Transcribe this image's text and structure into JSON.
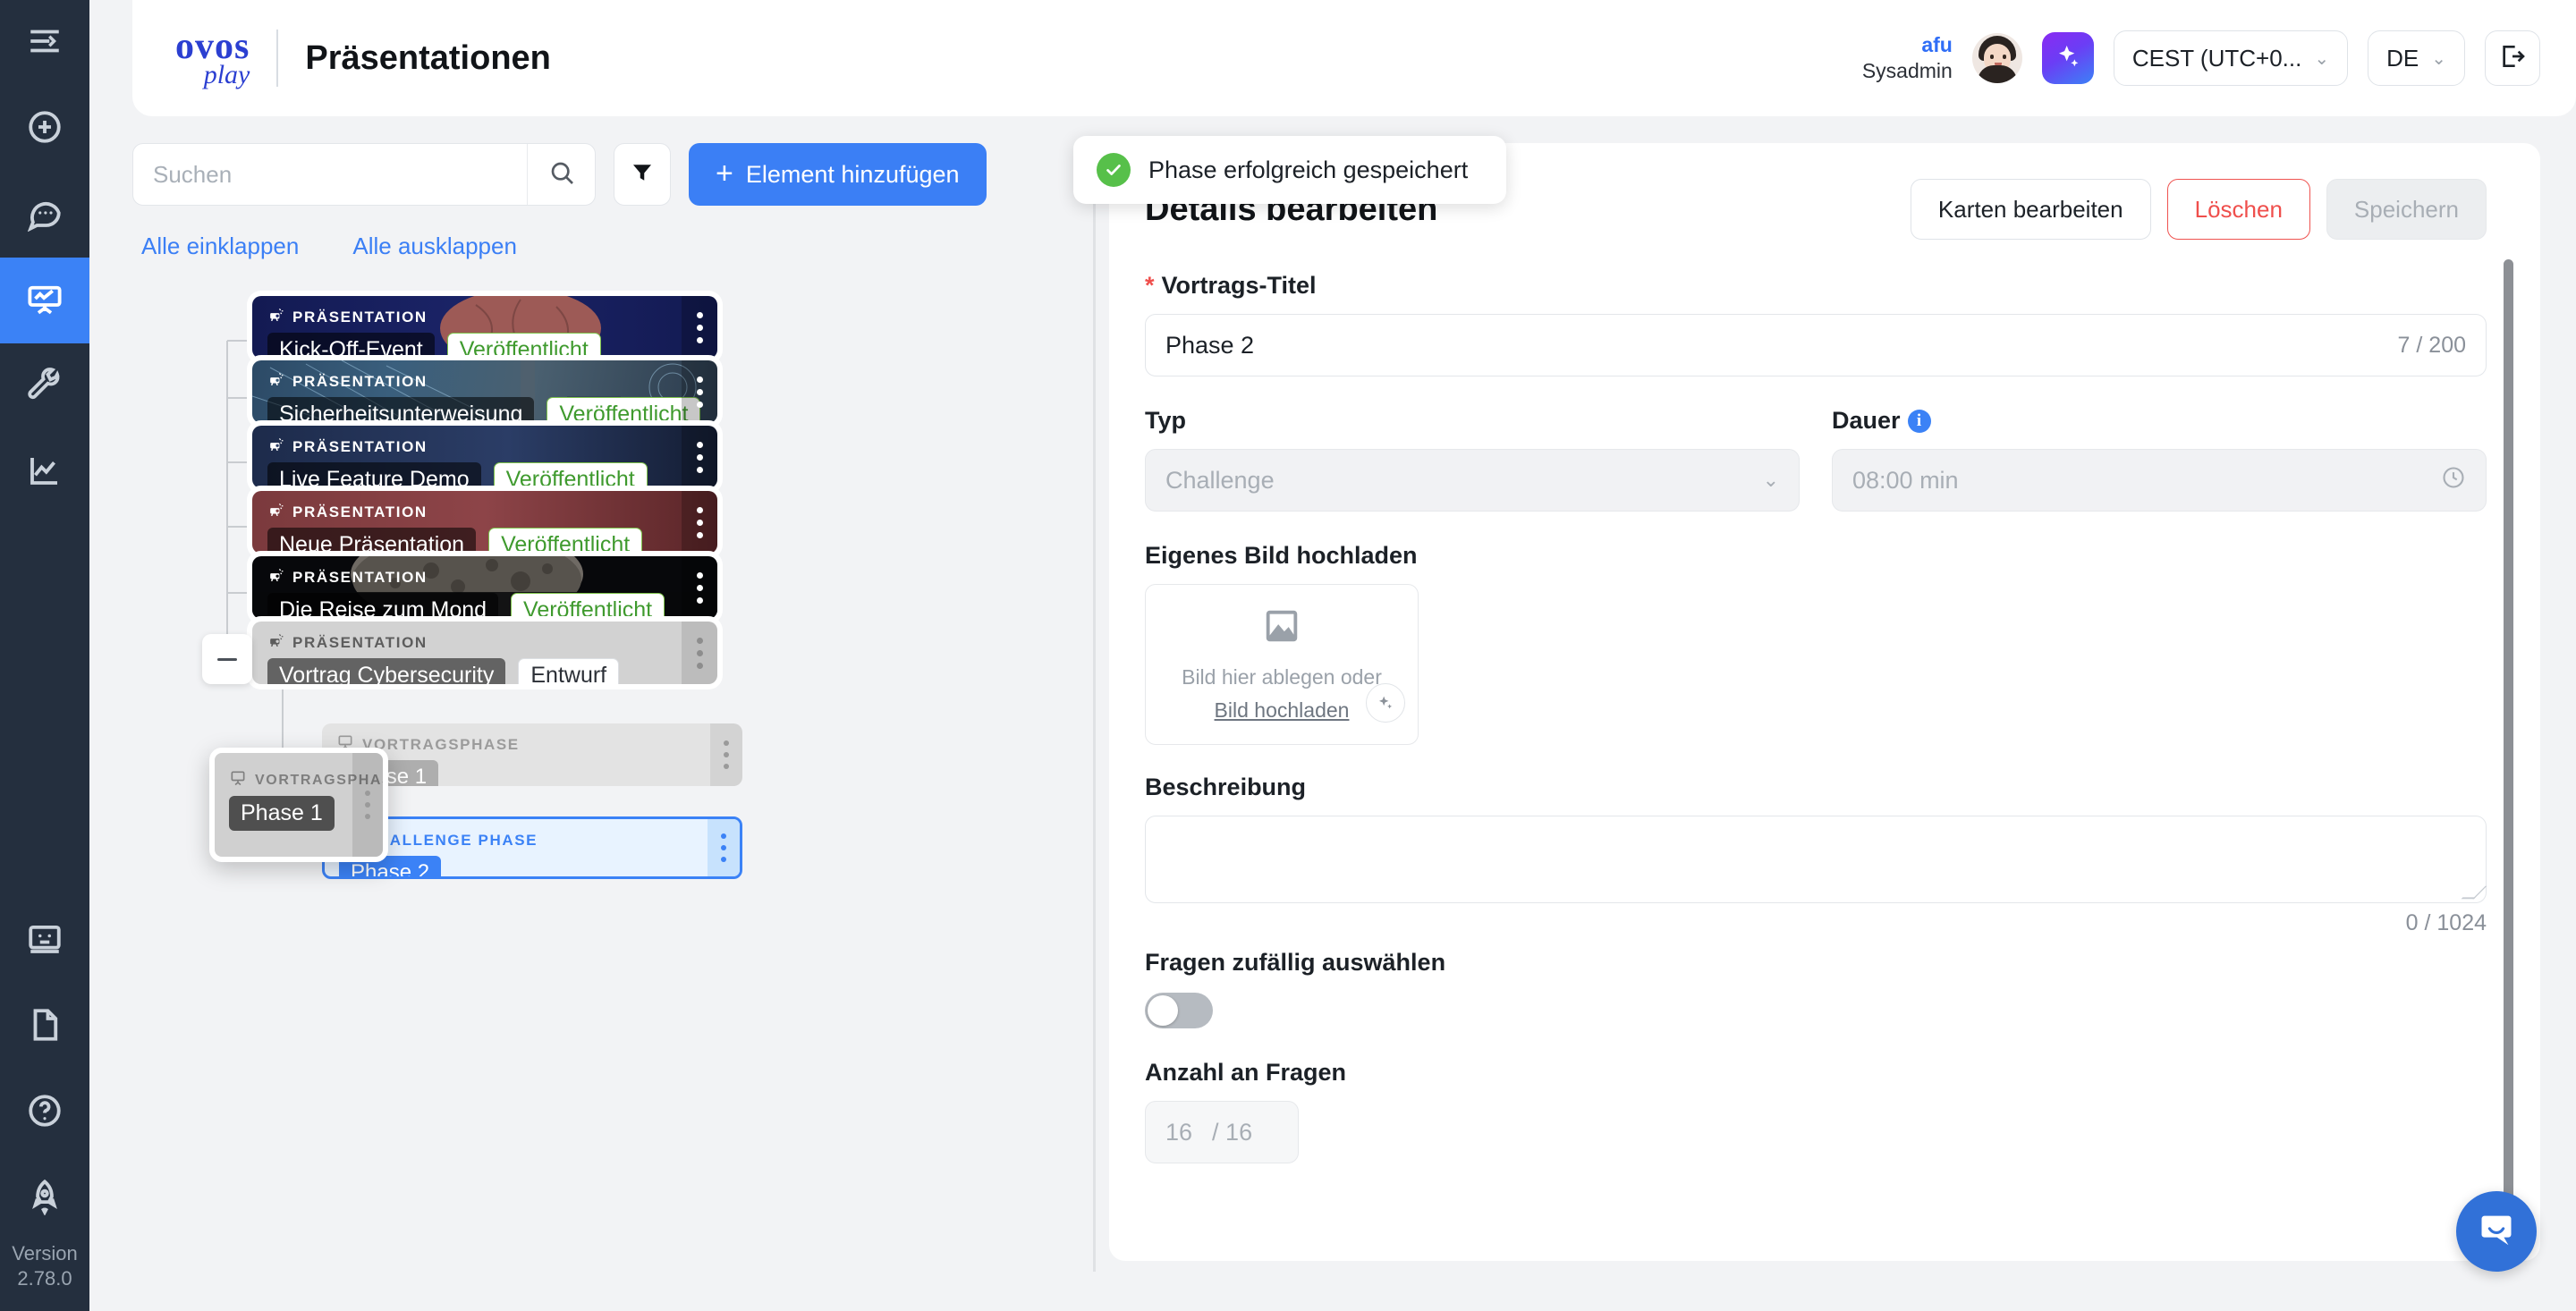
{
  "rail": {
    "items": [
      {
        "name": "menu-collapse-icon",
        "active": false
      },
      {
        "name": "add-circle-icon",
        "active": false
      },
      {
        "name": "chat-bubble-icon",
        "active": false
      },
      {
        "name": "presentation-icon",
        "active": true
      },
      {
        "name": "wrench-icon",
        "active": false
      },
      {
        "name": "analytics-icon",
        "active": false
      }
    ],
    "bottom_items": [
      {
        "name": "id-card-icon"
      },
      {
        "name": "document-icon"
      },
      {
        "name": "help-circle-icon"
      },
      {
        "name": "rocket-icon"
      }
    ],
    "version_label": "Version\n2.78.0"
  },
  "header": {
    "logo_line1": "ovos",
    "logo_line2": "play",
    "page_title": "Präsentationen",
    "user_name": "afu",
    "user_role": "Sysadmin",
    "ai_button_label": "AI",
    "timezone": "CEST (UTC+0...",
    "language": "DE",
    "logout_label": "Abmelden"
  },
  "toolbar": {
    "search_placeholder": "Suchen",
    "search_value": "",
    "filter_label": "Filter",
    "add_label": "Element hinzufügen",
    "collapse_all": "Alle einklappen",
    "expand_all": "Alle ausklappen"
  },
  "toast": {
    "message": "Phase erfolgreich gespeichert",
    "icon": "check-circle-icon",
    "color": "#57c04a"
  },
  "tree": {
    "presentations": [
      {
        "kicker": "PRÄSENTATION",
        "name": "Kick-Off-Event",
        "status": "Veröffentlicht",
        "state": "published"
      },
      {
        "kicker": "PRÄSENTATION",
        "name": "Sicherheitsunterweisung",
        "status": "Veröffentlicht",
        "state": "published"
      },
      {
        "kicker": "PRÄSENTATION",
        "name": "Live Feature Demo",
        "status": "Veröffentlicht",
        "state": "published"
      },
      {
        "kicker": "PRÄSENTATION",
        "name": "Neue Präsentation",
        "status": "Veröffentlicht",
        "state": "published"
      },
      {
        "kicker": "PRÄSENTATION",
        "name": "Die Reise zum Mond",
        "status": "Veröffentlicht",
        "state": "published"
      },
      {
        "kicker": "PRÄSENTATION",
        "name": "Vortrag Cybersecurity",
        "status": "Entwurf",
        "state": "draft"
      }
    ],
    "phases": [
      {
        "kicker": "VORTRAGSPHASE",
        "name": "Phase 1",
        "selected": false
      },
      {
        "kicker": "CHALLENGE PHASE",
        "name": "Phase 2",
        "selected": true
      }
    ],
    "drag_ghost": {
      "kicker": "VORTRAGSPHASE",
      "name": "Phase 1"
    }
  },
  "form": {
    "title": "Details bearbeiten",
    "btn_edit_cards": "Karten bearbeiten",
    "btn_delete": "Löschen",
    "btn_save": "Speichern",
    "title_label": "Vortrags-Titel",
    "title_required_mark": "*",
    "title_value": "Phase 2",
    "title_counter": "7 / 200",
    "type_label": "Typ",
    "type_value": "Challenge",
    "duration_label": "Dauer",
    "duration_value": "08:00 min",
    "upload_label": "Eigenes Bild hochladen",
    "upload_hint": "Bild hier ablegen oder",
    "upload_link": "Bild hochladen",
    "description_label": "Beschreibung",
    "description_value": "",
    "description_counter": "0 / 1024",
    "random_label": "Fragen zufällig auswählen",
    "random_enabled": false,
    "count_label": "Anzahl an Fragen",
    "count_value": "16",
    "count_max": "/ 16"
  },
  "intercom": {
    "name": "intercom-chat-icon"
  },
  "colors": {
    "accent": "#3b7ff5",
    "danger": "#ef4f4c",
    "success": "#57c04a",
    "rail_bg": "#242f3e"
  }
}
